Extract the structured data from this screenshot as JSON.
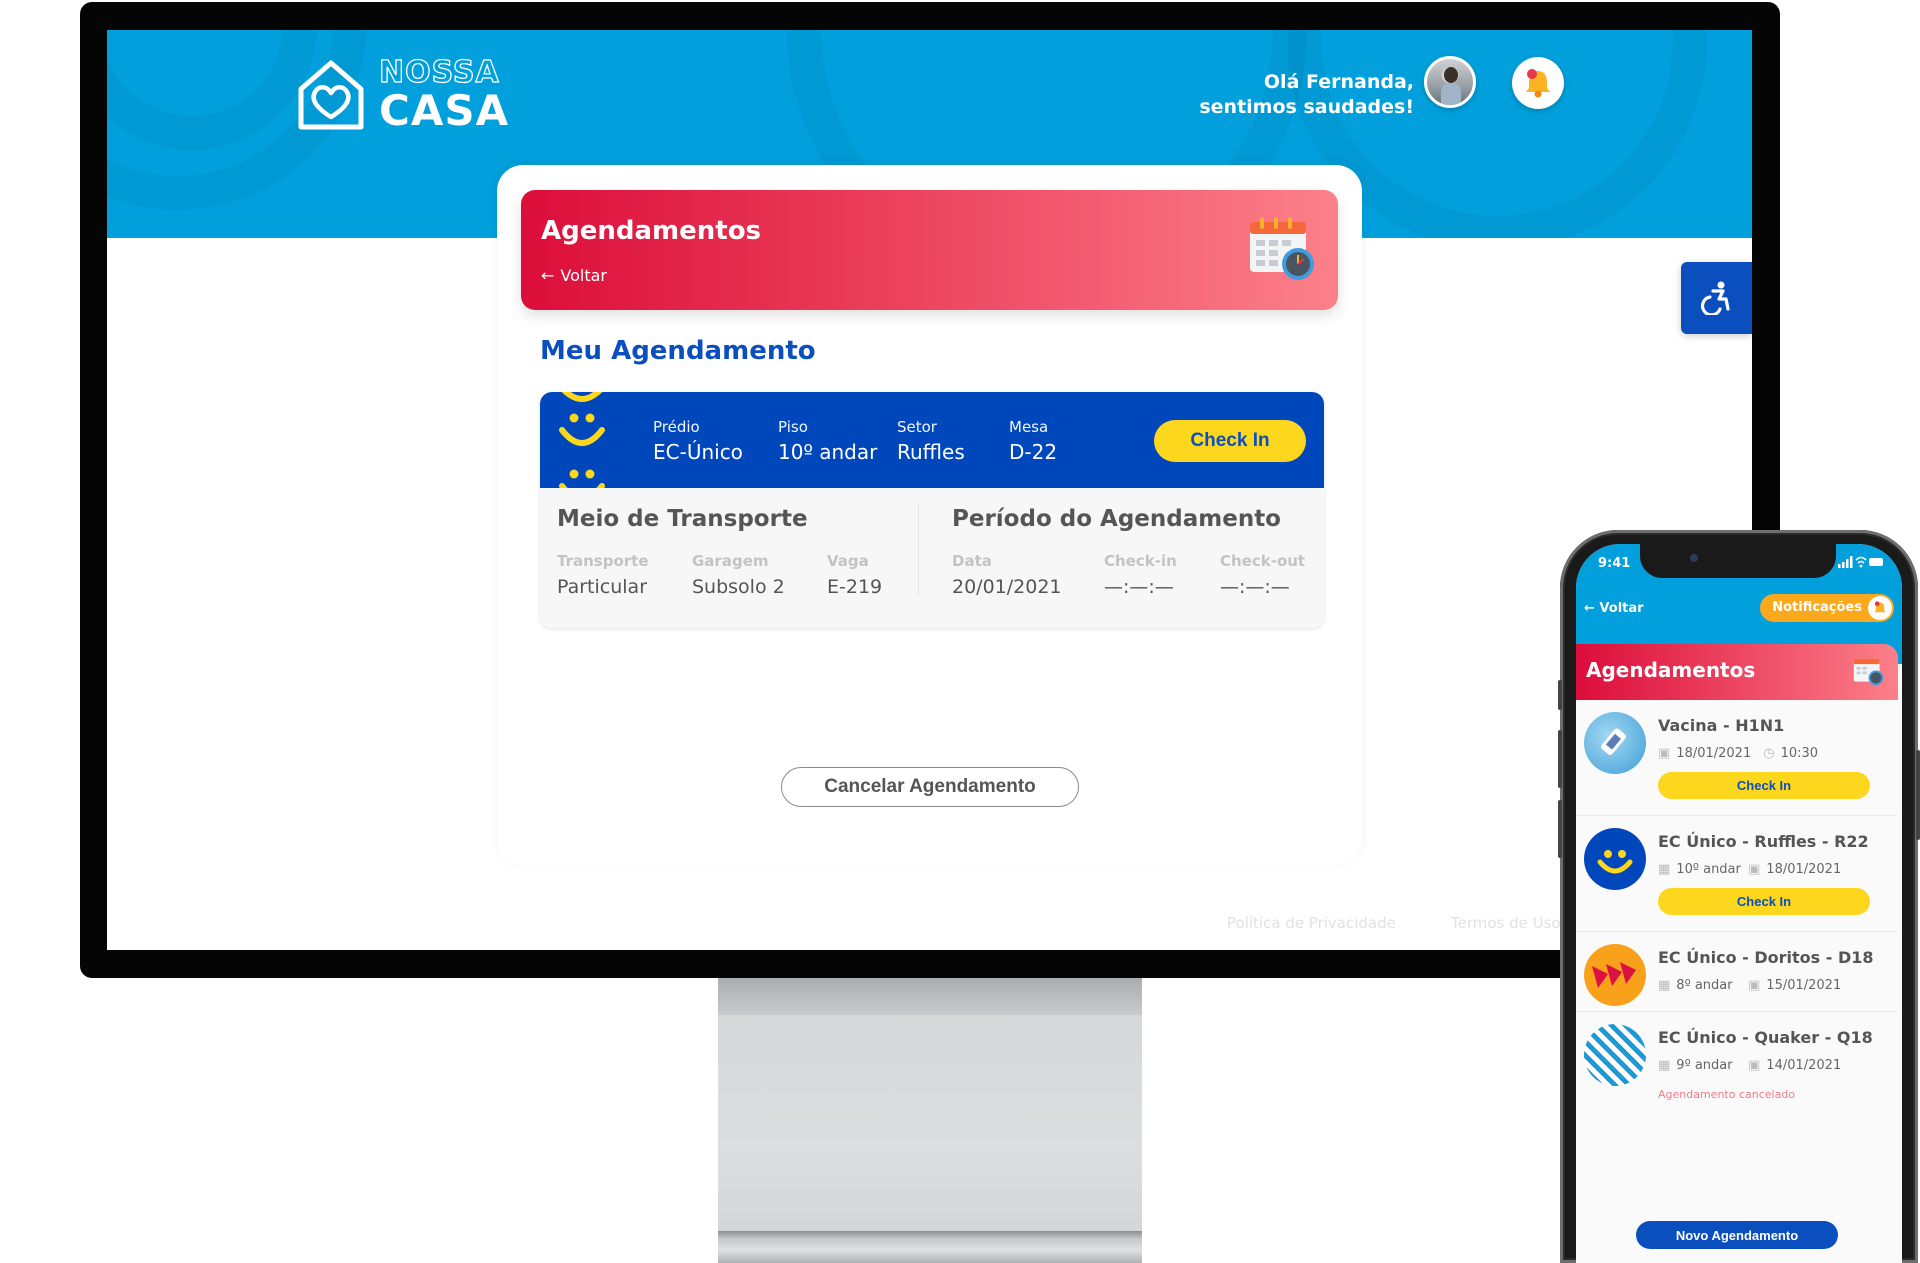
{
  "desktop": {
    "logo": {
      "line1": "NOSSA",
      "line2": "CASA"
    },
    "greeting": {
      "line1": "Olá Fernanda,",
      "line2": "sentimos saudades!"
    },
    "banner": {
      "title": "Agendamentos",
      "back_label": "Voltar"
    },
    "section_title": "Meu Agendamento",
    "booking": {
      "fields": [
        {
          "label": "Prédio",
          "value": "EC-Único"
        },
        {
          "label": "Piso",
          "value": "10º andar"
        },
        {
          "label": "Setor",
          "value": "Ruffles"
        },
        {
          "label": "Mesa",
          "value": "D-22"
        }
      ],
      "checkin_label": "Check In",
      "transport": {
        "title": "Meio de Transporte",
        "fields": [
          {
            "label": "Transporte",
            "value": "Particular"
          },
          {
            "label": "Garagem",
            "value": "Subsolo 2"
          },
          {
            "label": "Vaga",
            "value": "E-219"
          }
        ]
      },
      "period": {
        "title": "Período do Agendamento",
        "fields": [
          {
            "label": "Data",
            "value": "20/01/2021"
          },
          {
            "label": "Check-in",
            "value": "—:—:—"
          },
          {
            "label": "Check-out",
            "value": "—:—:—"
          }
        ]
      }
    },
    "cancel_label": "Cancelar Agendamento",
    "footer": {
      "privacy": "Política de Privacidade",
      "terms": "Termos de Uso"
    },
    "icons": {
      "accessibility": "wheelchair-icon",
      "notifications": "bell-icon",
      "calendar": "calendar-clock-icon"
    }
  },
  "mobile": {
    "status_time": "9:41",
    "back_label": "Voltar",
    "notifications_label": "Notificações",
    "banner_title": "Agendamentos",
    "items": [
      {
        "title": "Vacina - H1N1",
        "meta1": "18/01/2021",
        "meta2": "10:30",
        "action": "Check In",
        "icon": "vaccine-icon"
      },
      {
        "title": "EC Único - Ruffles - R22",
        "meta1": "10º andar",
        "meta2": "18/01/2021",
        "action": "Check In",
        "icon": "ruffles-smile-icon"
      },
      {
        "title": "EC Único - Doritos - D18",
        "meta1": "8º andar",
        "meta2": "15/01/2021",
        "icon": "doritos-icon"
      },
      {
        "title": "EC Único - Quaker - Q18",
        "meta1": "9º andar",
        "meta2": "14/01/2021",
        "status": "Agendamento cancelado",
        "icon": "quaker-stripes-icon"
      }
    ],
    "new_label": "Novo Agendamento"
  },
  "colors": {
    "brand_blue": "#019fdb",
    "primary_blue": "#0b4fbf",
    "accent_red": "#dc0d3a",
    "yellow": "#fdd61e",
    "orange": "#fba91c"
  }
}
